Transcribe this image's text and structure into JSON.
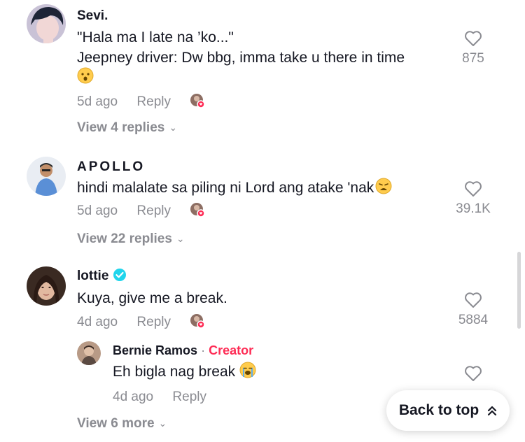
{
  "comments": [
    {
      "username": "Sevi.",
      "text_line1": "\"Hala ma I late na ’ko...\"",
      "text_line2": "Jeepney driver: Dw bbg, imma take u there in time",
      "emoji": "astonished-face",
      "time": "5d ago",
      "reply_label": "Reply",
      "likes": "875",
      "view_replies": "View 4 replies"
    },
    {
      "username": "APOLLO",
      "text": "hindi malalate sa piling ni Lord ang atake 'nak",
      "emoji": "weary-face",
      "time": "5d ago",
      "reply_label": "Reply",
      "likes": "39.1K",
      "view_replies": "View 22 replies"
    },
    {
      "username": "lottie",
      "verified": true,
      "text": "Kuya, give me a break.",
      "time": "4d ago",
      "reply_label": "Reply",
      "likes": "5884",
      "view_replies": "View 6 more",
      "reply": {
        "username": "Bernie Ramos",
        "separator": "·",
        "badge": "Creator",
        "text": "Eh bigla nag break",
        "emoji": "loudly-crying-face",
        "time": "4d ago",
        "reply_label": "Reply"
      }
    }
  ],
  "back_to_top": "Back to top",
  "colors": {
    "accent": "#fe2c55",
    "verified": "#20d5ec",
    "muted": "#8a8b91"
  }
}
